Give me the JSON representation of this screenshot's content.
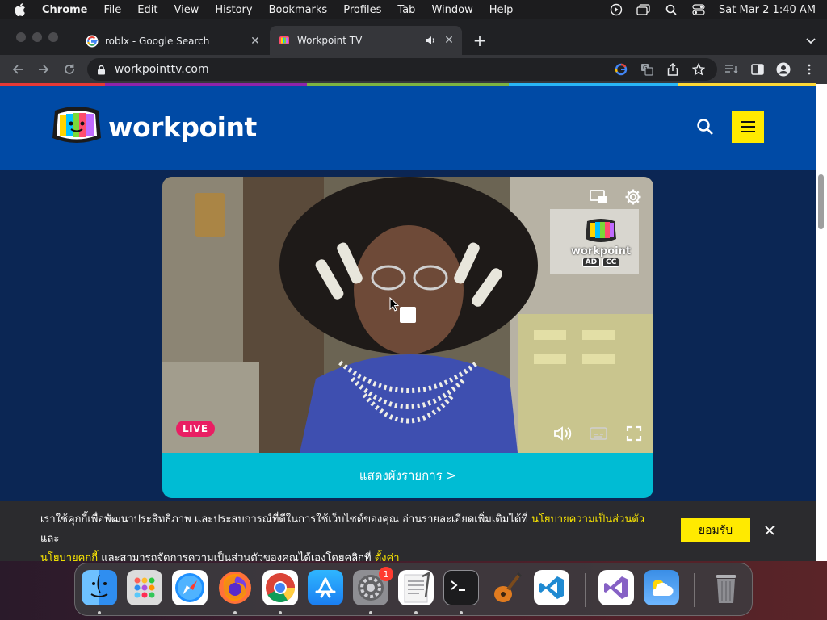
{
  "menubar": {
    "app_name": "Chrome",
    "menus": [
      "File",
      "Edit",
      "View",
      "History",
      "Bookmarks",
      "Profiles",
      "Tab",
      "Window",
      "Help"
    ],
    "clock": "Sat Mar 2  1:40 AM"
  },
  "tabs": [
    {
      "title": "roblx - Google Search",
      "favicon": "google-icon",
      "active": false
    },
    {
      "title": "Workpoint TV",
      "favicon": "workpoint-icon",
      "active": true,
      "audio": true
    }
  ],
  "toolbar": {
    "url": "workpointtv.com"
  },
  "site": {
    "brand": "workpoint",
    "colors": {
      "header": "#004aa5",
      "page_bg": "#0b2654",
      "accent_yellow": "#ffea00",
      "cyan": "#00bcd4",
      "live": "#e91e63"
    }
  },
  "player": {
    "live_label": "LIVE",
    "schedule_label": "แสดงผังรายการ >",
    "watermark_brand": "workpoint",
    "watermark_ad": "AD",
    "watermark_cc": "CC"
  },
  "cookie": {
    "text_1": "เราใช้คุกกี้เพื่อพัฒนาประสิทธิภาพ และประสบการณ์ที่ดีในการใช้เว็บไซต์ของคุณ อ่านรายละเอียดเพิ่มเติมได้ที่ ",
    "link_privacy": "นโยบายความเป็นส่วนตัว",
    "text_and": " และ",
    "link_cookie": "นโยบายคุกกี้",
    "text_2": " และสามารถจัดการความเป็นส่วนตัวของคุณได้เองโดยคลิกที่ ",
    "link_settings": "ตั้งค่า",
    "accept_label": "ยอมรับ"
  },
  "dock": {
    "apps": [
      "Finder",
      "Launchpad",
      "Safari",
      "Firefox",
      "Chrome",
      "App Store",
      "System Preferences",
      "TextEdit",
      "Terminal",
      "GarageBand",
      "Visual Studio Code",
      "Visual Studio",
      "Weather",
      "Trash"
    ],
    "system_prefs_badge": "1"
  }
}
